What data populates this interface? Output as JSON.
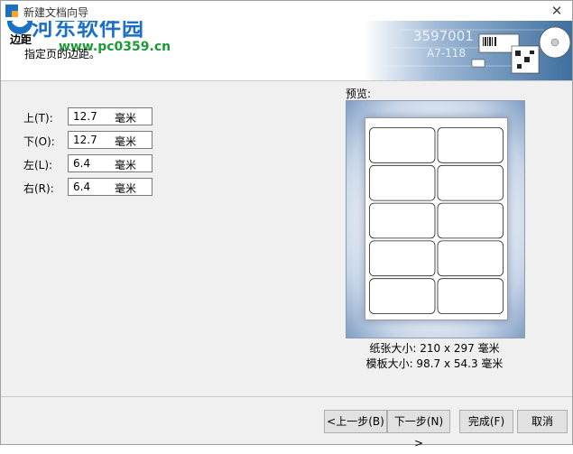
{
  "window": {
    "title": "新建文档向导"
  },
  "watermark": {
    "name": "河东软件园",
    "url": "www.pc0359.cn"
  },
  "header": {
    "title": "边距",
    "subtitle": "指定页的边距。"
  },
  "banner": {
    "code": "3597001",
    "code2": "A7-118"
  },
  "margins": [
    {
      "label": "上(T):",
      "value": "12.7",
      "unit": "毫米"
    },
    {
      "label": "下(O):",
      "value": "12.7",
      "unit": "毫米"
    },
    {
      "label": "左(L):",
      "value": "6.4",
      "unit": "毫米"
    },
    {
      "label": "右(R):",
      "value": "6.4",
      "unit": "毫米"
    }
  ],
  "preview": {
    "label": "预览:",
    "paper_size": "纸张大小: 210 x 297 毫米",
    "template_size": "模板大小: 98.7 x 54.3 毫米",
    "columns": 2,
    "rows": 5
  },
  "buttons": {
    "back": "<上一步(B)",
    "next": "下一步(N) >",
    "finish": "完成(F)",
    "cancel": "取消"
  }
}
